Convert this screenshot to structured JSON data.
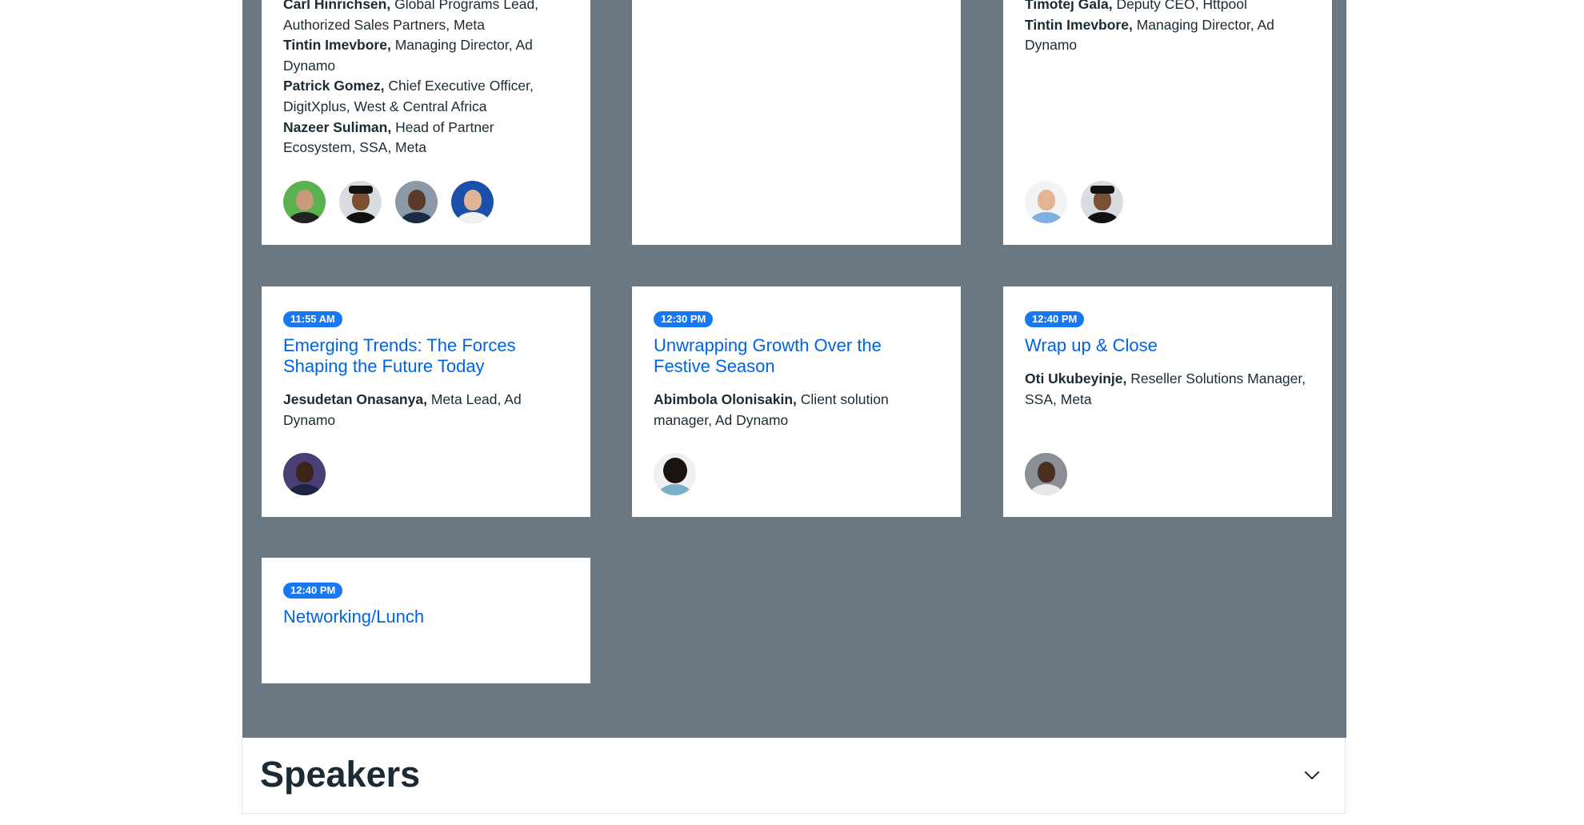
{
  "cards": [
    {
      "time": "",
      "title": "",
      "speakers": [
        {
          "name": "Carl Hinrichsen,",
          "role": " Global Programs Lead, Authorized Sales Partners, Meta"
        },
        {
          "name": "Tintin Imevbore,",
          "role": " Managing Director, Ad Dynamo"
        },
        {
          "name": "Patrick Gomez,",
          "role": " Chief Executive Officer, DigitXplus, West & Central Africa"
        },
        {
          "name": "Nazeer Suliman,",
          "role": " Head of Partner Ecosystem, SSA, Meta"
        }
      ],
      "avatars": [
        "avatar-carl",
        "avatar-tintin",
        "avatar-patrick",
        "avatar-nazeer"
      ]
    },
    {
      "time": "",
      "title": "",
      "speakers": [
        {
          "name": "Timotej Gala,",
          "role": " Deputy CEO, Httpool"
        },
        {
          "name": "Tintin Imevbore,",
          "role": " Managing Director, Ad Dynamo"
        }
      ],
      "avatars": [
        "avatar-timotej",
        "avatar-tintin"
      ]
    },
    {
      "time": "11:55 AM",
      "title": "Emerging Trends: The Forces Shaping the Future Today",
      "speakers": [
        {
          "name": "Jesudetan Onasanya,",
          "role": " Meta Lead, Ad Dynamo"
        }
      ],
      "avatars": [
        "avatar-jesudetan"
      ]
    },
    {
      "time": "12:30 PM",
      "title": "Unwrapping Growth Over the Festive Season",
      "speakers": [
        {
          "name": "Abimbola Olonisakin,",
          "role": " Client solution manager, Ad Dynamo"
        }
      ],
      "avatars": [
        "avatar-abimbola"
      ]
    },
    {
      "time": "12:40 PM",
      "title": "Wrap up & Close",
      "speakers": [
        {
          "name": "Oti Ukubeyinje,",
          "role": " Reseller Solutions Manager, SSA, Meta"
        }
      ],
      "avatars": [
        "avatar-oti"
      ]
    },
    {
      "time": "12:40 PM",
      "title": "Networking/Lunch",
      "speakers": [],
      "avatars": []
    }
  ],
  "speakers_section": {
    "heading": "Speakers",
    "toggle_icon": "chevron-down-icon"
  },
  "colors": {
    "agenda_background": "#6b7781",
    "badge": "#1877f2",
    "title_link": "#0064e0",
    "text": "#1c2b33"
  }
}
